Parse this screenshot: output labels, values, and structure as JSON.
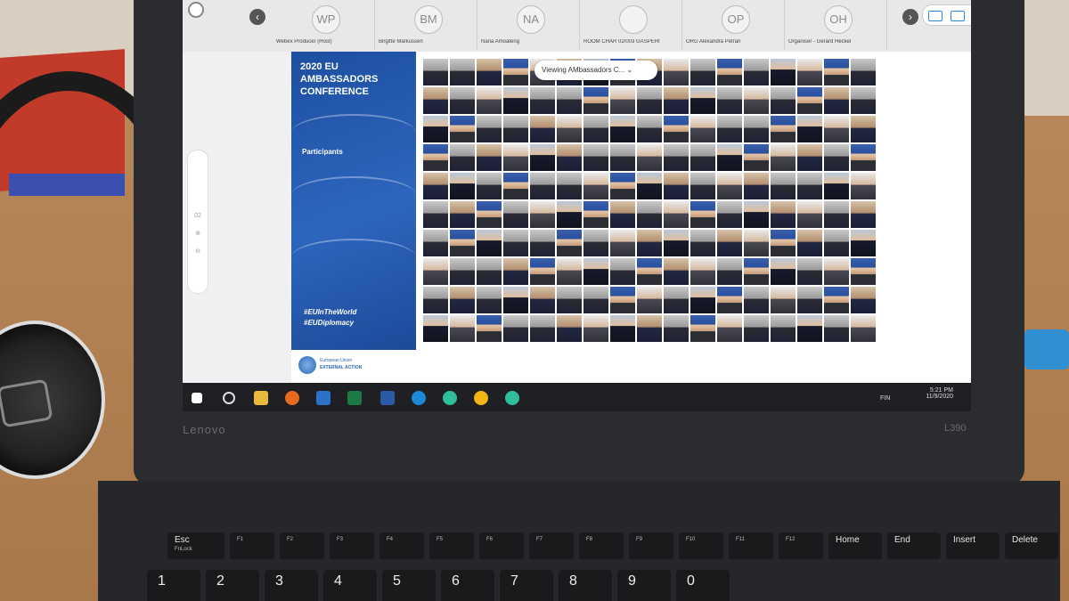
{
  "topbar": {
    "participants": [
      {
        "initials": "WP",
        "name": "Webex Producer (Host)"
      },
      {
        "initials": "BM",
        "name": "Birgitte Markussen"
      },
      {
        "initials": "NA",
        "name": "Nana Amoateng"
      },
      {
        "initials": "",
        "name": "ROOM CHAR 02/003 GASPERI"
      },
      {
        "initials": "OP",
        "name": "ORG Alexandra Petran"
      },
      {
        "initials": "OH",
        "name": "Organiser - Gerard Heckel"
      }
    ]
  },
  "zoom": {
    "level": "02"
  },
  "slide": {
    "title": "2020 EU AMBASSADORS CONFERENCE",
    "subtitle": "Participants",
    "tags": [
      "#EUInTheWorld",
      "#EUDiplomacy"
    ],
    "logo_line1": "European Union",
    "logo_line2": "EXTERNAL ACTION"
  },
  "viewing_label": "Viewing AMbassadors C...",
  "taskbar": {
    "lang": "FIN",
    "time": "5:21 PM",
    "date": "11/9/2020"
  },
  "laptop": {
    "brand": "Lenovo",
    "model": "L390"
  },
  "keyboard": {
    "function_row": [
      {
        "label": "Esc",
        "sub": "FnLock"
      },
      {
        "label": "",
        "sub": "F1"
      },
      {
        "label": "",
        "sub": "F2"
      },
      {
        "label": "",
        "sub": "F3"
      },
      {
        "label": "",
        "sub": "F4"
      },
      {
        "label": "",
        "sub": "F5"
      },
      {
        "label": "",
        "sub": "F6"
      },
      {
        "label": "",
        "sub": "F7"
      },
      {
        "label": "",
        "sub": "F8"
      },
      {
        "label": "",
        "sub": "F9"
      },
      {
        "label": "",
        "sub": "F10"
      },
      {
        "label": "",
        "sub": "F11"
      },
      {
        "label": "",
        "sub": "F12"
      },
      {
        "label": "Home",
        "sub": ""
      },
      {
        "label": "End",
        "sub": ""
      },
      {
        "label": "Insert",
        "sub": ""
      },
      {
        "label": "Delete",
        "sub": ""
      }
    ],
    "number_row": [
      "1",
      "2",
      "3",
      "4",
      "5",
      "6",
      "7",
      "8",
      "9",
      "0"
    ]
  }
}
